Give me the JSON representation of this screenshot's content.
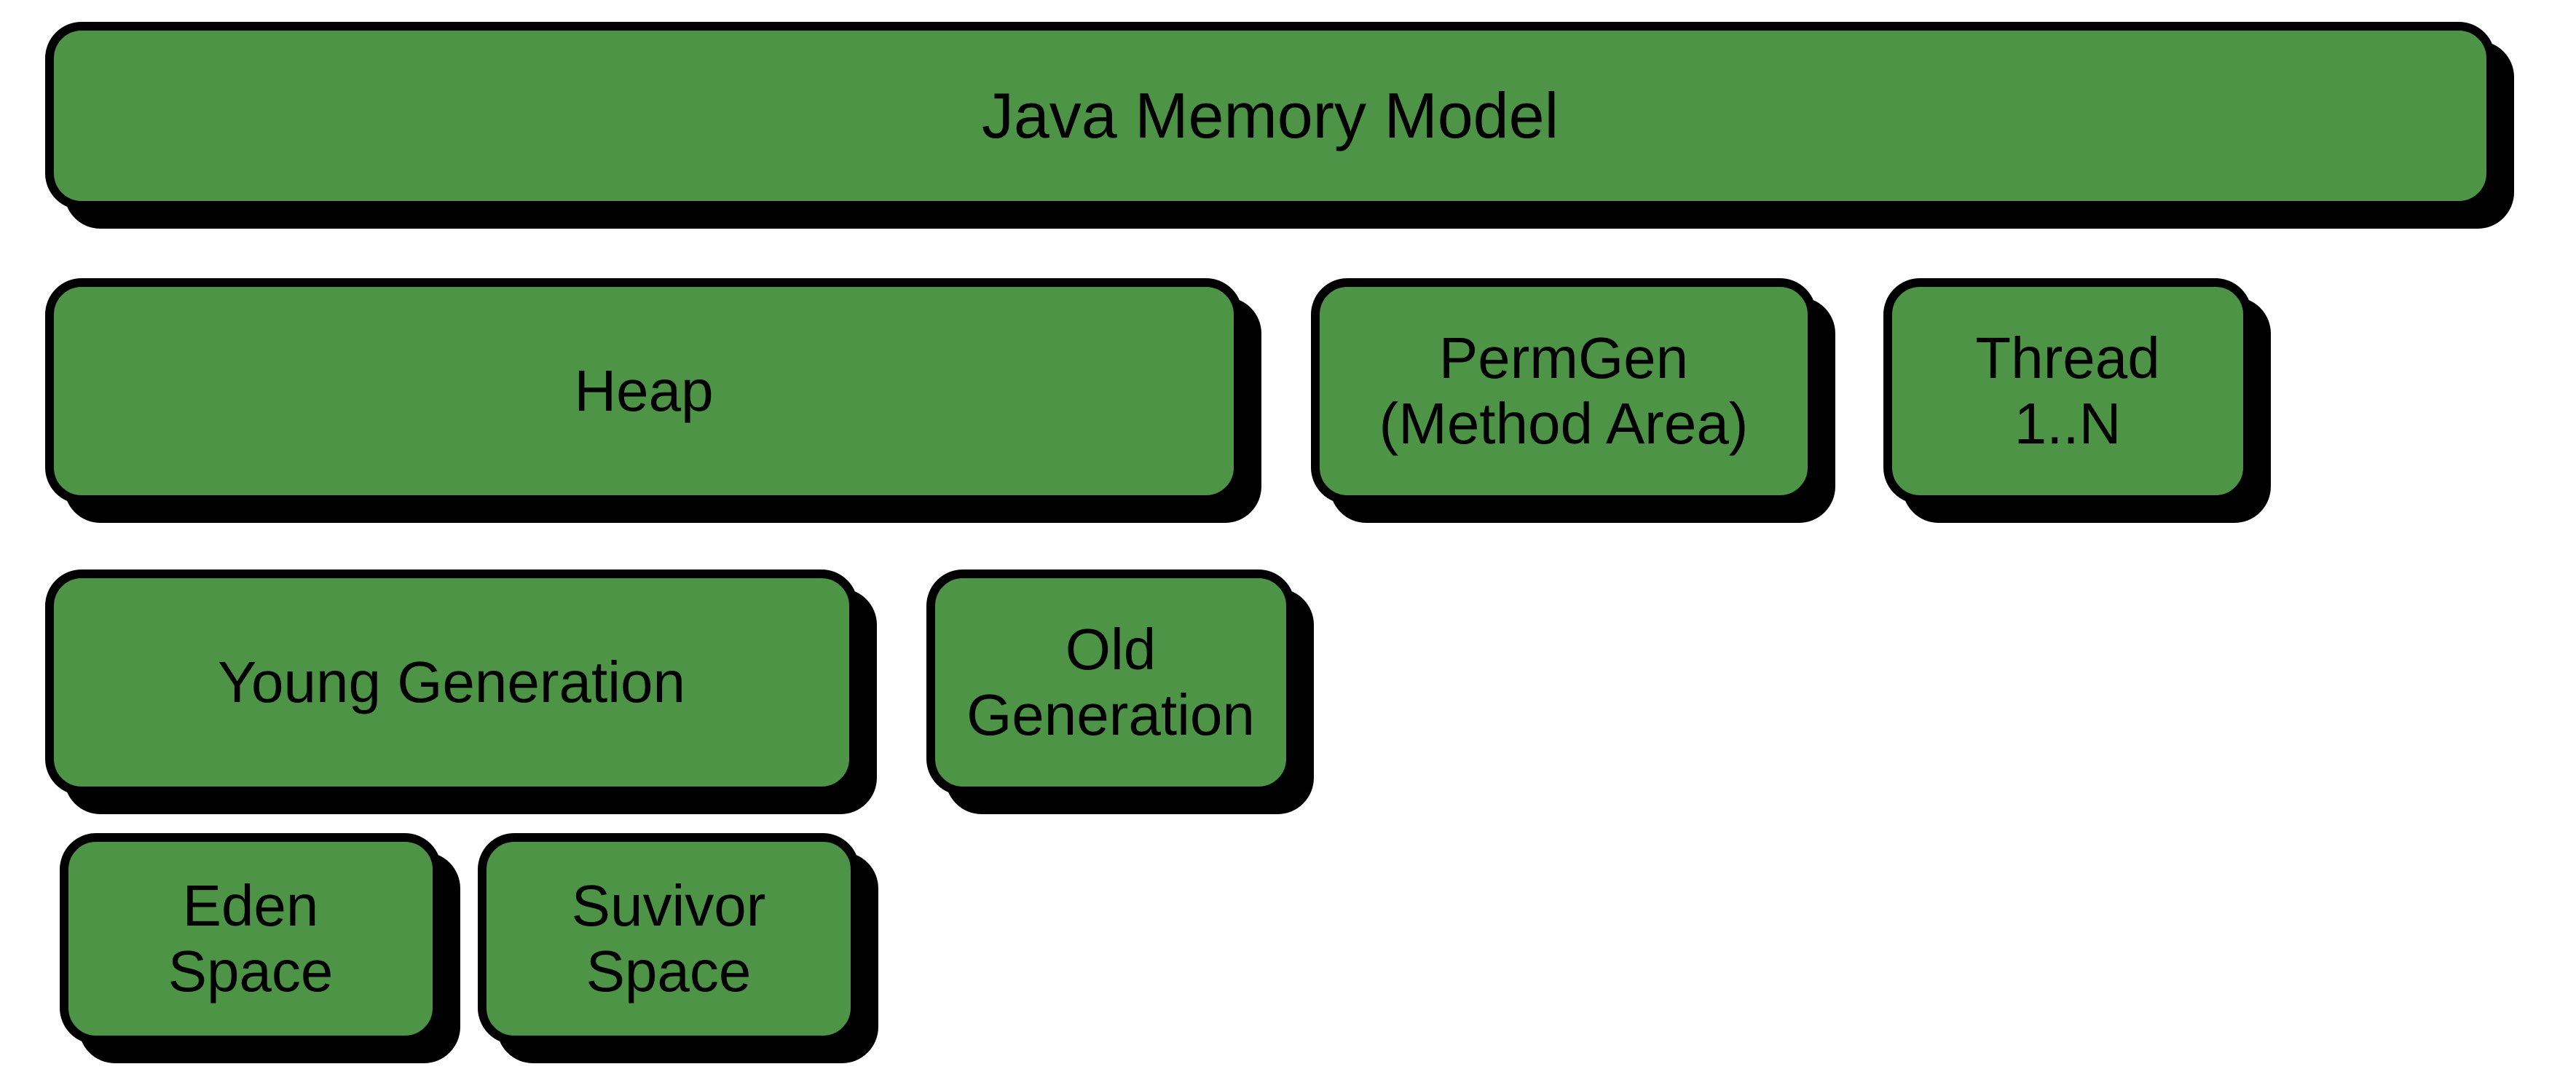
{
  "colors": {
    "fill": "#4d9446",
    "stroke": "#000000"
  },
  "blocks": {
    "title": "Java Memory Model",
    "heap": "Heap",
    "permgen_line1": "PermGen",
    "permgen_line2": "(Method Area)",
    "thread_line1": "Thread",
    "thread_line2": "1..N",
    "young": "Young Generation",
    "old_line1": "Old",
    "old_line2": "Generation",
    "eden_line1": "Eden",
    "eden_line2": "Space",
    "survivor_line1": "Suvivor",
    "survivor_line2": "Space"
  }
}
